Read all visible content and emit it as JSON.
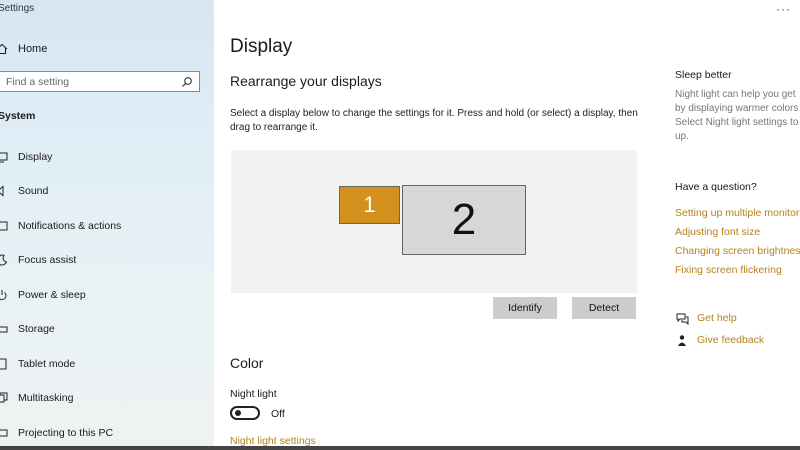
{
  "window": {
    "title": "Settings",
    "more_label": "···"
  },
  "sidebar": {
    "home_label": "Home",
    "search_placeholder": "Find a setting",
    "section_label": "System",
    "items": [
      {
        "label": "Display",
        "icon": "monitor-icon"
      },
      {
        "label": "Sound",
        "icon": "speaker-icon"
      },
      {
        "label": "Notifications & actions",
        "icon": "notification-icon"
      },
      {
        "label": "Focus assist",
        "icon": "moon-icon"
      },
      {
        "label": "Power & sleep",
        "icon": "power-icon"
      },
      {
        "label": "Storage",
        "icon": "storage-icon"
      },
      {
        "label": "Tablet mode",
        "icon": "tablet-icon"
      },
      {
        "label": "Multitasking",
        "icon": "multitasking-icon"
      },
      {
        "label": "Projecting to this PC",
        "icon": "projector-icon"
      }
    ]
  },
  "main": {
    "title": "Display",
    "subheading": "Rearrange your displays",
    "description": "Select a display below to change the settings for it. Press and hold (or select) a display, then drag to rearrange it.",
    "monitors": [
      "1",
      "2"
    ],
    "identify_label": "Identify",
    "detect_label": "Detect",
    "color_heading": "Color",
    "night_light_label": "Night light",
    "night_light_state": "Off",
    "night_light_link": "Night light settings"
  },
  "right_panel": {
    "sleep_heading": "Sleep better",
    "sleep_lines": [
      "Night light can help you get",
      "by displaying warmer colors",
      "Select Night light settings to",
      "up."
    ],
    "question_heading": "Have a question?",
    "links": [
      "Setting up multiple monitors",
      "Adjusting font size",
      "Changing screen brightness",
      "Fixing screen flickering"
    ],
    "get_help": "Get help",
    "give_feedback": "Give feedback"
  },
  "colors": {
    "accent": "#d4901c",
    "link": "#b5821a"
  }
}
